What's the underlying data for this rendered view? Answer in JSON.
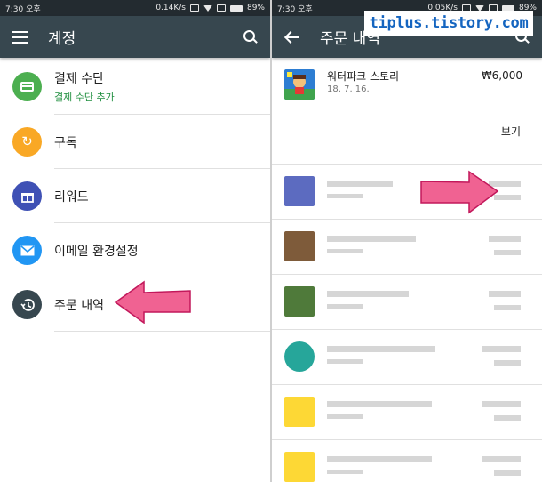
{
  "left": {
    "status": {
      "time": "7:30 오후",
      "speed": "0.14K/s",
      "battery": "89%"
    },
    "appbar": {
      "title": "계정"
    },
    "items": [
      {
        "label": "결제 수단",
        "sub": "결제 수단 추가",
        "color": "#4caf50",
        "icon": "credit-card-icon"
      },
      {
        "label": "구독",
        "color": "#f9a825",
        "icon": "refresh-icon"
      },
      {
        "label": "리워드",
        "color": "#3f51b5",
        "icon": "gift-icon"
      },
      {
        "label": "이메일 환경설정",
        "color": "#2196f3",
        "icon": "mail-icon"
      },
      {
        "label": "주문 내역",
        "color": "#37474f",
        "icon": "history-icon"
      }
    ]
  },
  "right": {
    "status": {
      "time": "7:30 오후",
      "speed": "0.05K/s",
      "battery": "89%"
    },
    "appbar": {
      "title": "주문 내역"
    },
    "first_order": {
      "name": "워터파크 스토리",
      "date": "18. 7. 16.",
      "price": "₩6,000",
      "view": "보기"
    }
  },
  "watermark": "tiplus.tistory.com",
  "colors": {
    "appbar": "#37474f",
    "statusbar": "#232b30",
    "arrow": "#f06292",
    "accent_green": "#1e8e3e"
  }
}
